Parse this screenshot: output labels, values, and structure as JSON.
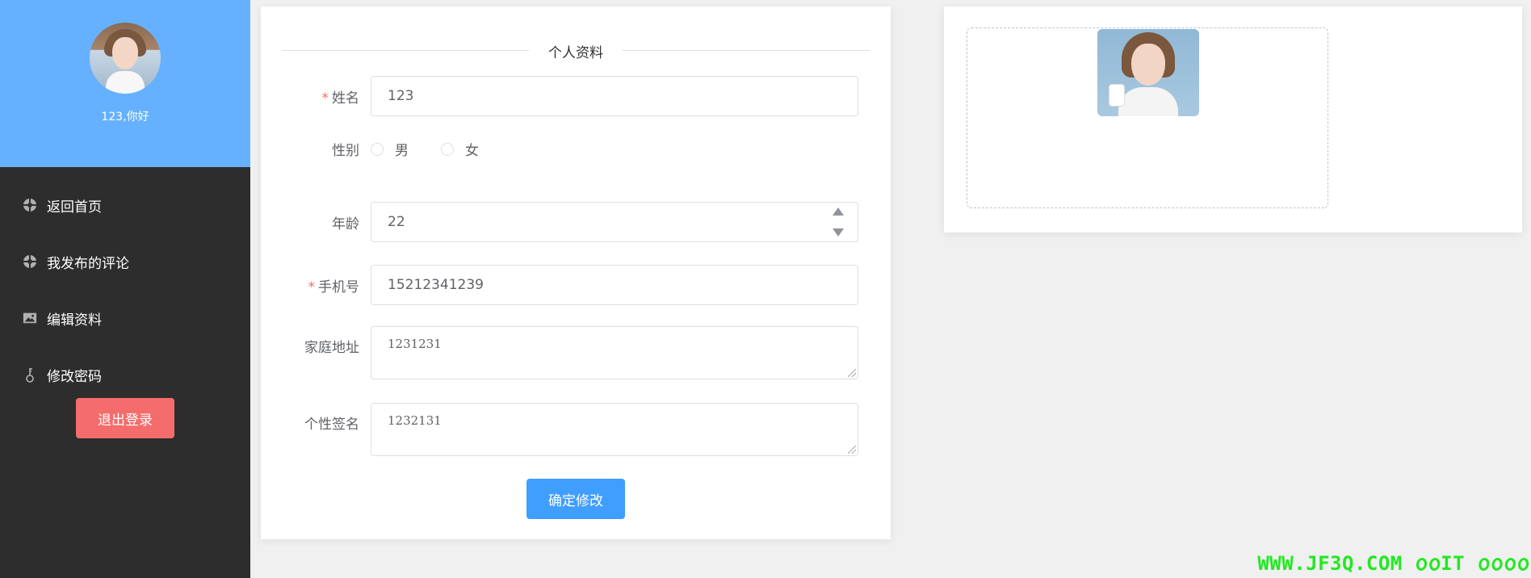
{
  "sidebar": {
    "greeting": "123,你好",
    "items": [
      {
        "label": "返回首页",
        "icon": "dashboard-icon"
      },
      {
        "label": "我发布的评论",
        "icon": "dashboard-icon"
      },
      {
        "label": "编辑资料",
        "icon": "image-icon"
      },
      {
        "label": "修改密码",
        "icon": "key-icon"
      }
    ],
    "logout_label": "退出登录"
  },
  "form": {
    "title": "个人资料",
    "name_label": "姓名",
    "name_value": "123",
    "gender_label": "性别",
    "gender_options": [
      "男",
      "女"
    ],
    "age_label": "年龄",
    "age_value": "22",
    "phone_label": "手机号",
    "phone_value": "15212341239",
    "address_label": "家庭地址",
    "address_value": "1231231",
    "signature_label": "个性签名",
    "signature_value": "1232131",
    "submit_label": "确定修改",
    "required_mark": "*"
  },
  "watermark": "WWW.JF3Q.COM 𐒠𐒠IT 𐒠𐒠𐒠𐒠",
  "colors": {
    "sidebar_bg": "#2d2d2d",
    "profile_bg": "#66b1ff",
    "logout": "#f56c6c",
    "primary": "#409eff",
    "watermark": "#22e822"
  }
}
